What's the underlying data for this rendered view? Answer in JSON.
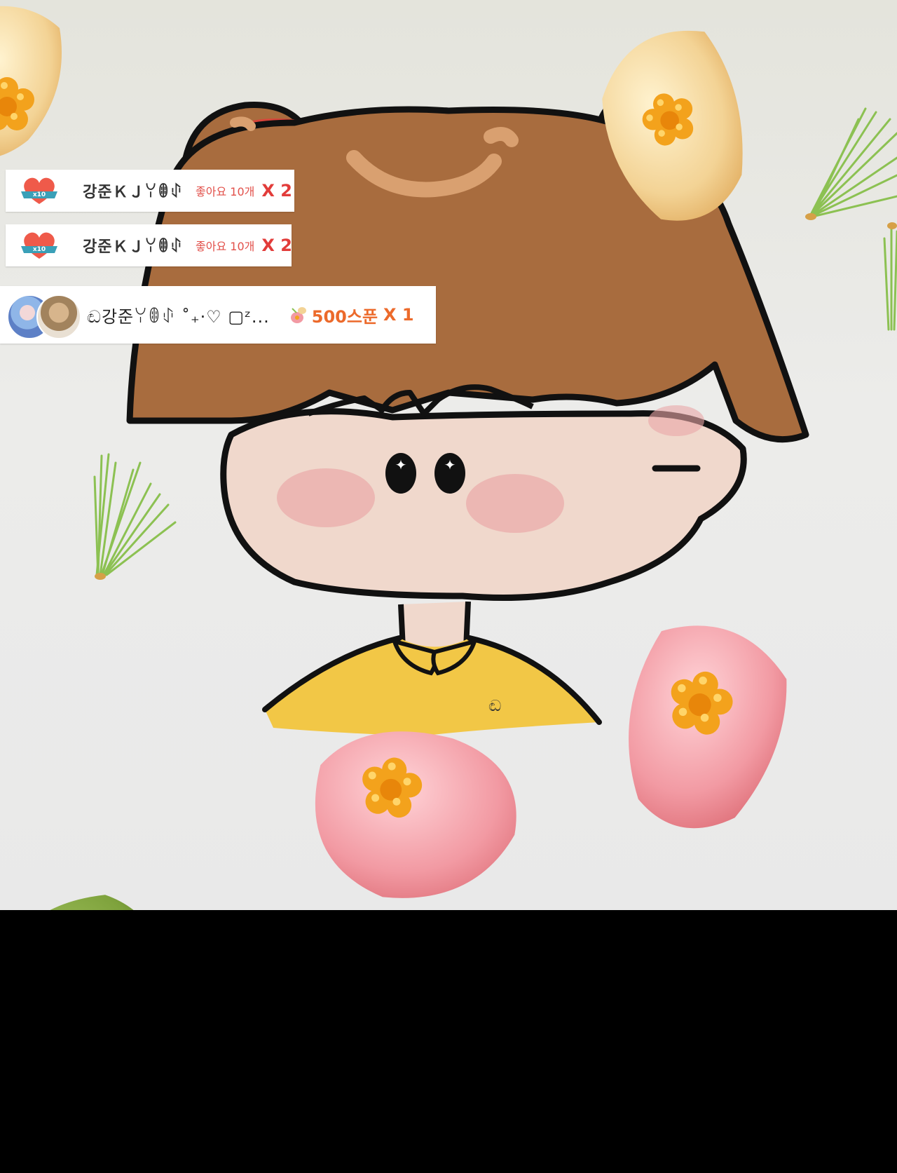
{
  "gift_feed": [
    {
      "badge_label": "x10",
      "user": "강준ＫＪꌩꂦꂑ",
      "item": "좋아요 10개",
      "count": "X 2"
    },
    {
      "badge_label": "x10",
      "user": "강준ＫＪꌩꂦꂑ",
      "item": "좋아요 10개",
      "count": "X 2"
    }
  ],
  "spoon_gift": {
    "user": "ඬ강준ꌩꂦꂑ ˚₊·♡ ▢ᶻ...",
    "amount": "500스푼",
    "count": "X 1"
  },
  "signature_mark": "ඬ",
  "colors": {
    "hair": "#a86c3e",
    "face": "#f0d8cc",
    "shirt": "#f2c746",
    "cake_pink": "#f29aa3",
    "cake_yellow": "#f3d395",
    "cake_green": "#7ea23c",
    "flower_orange": "#f3a21c",
    "gift_text_red": "#e23c3a",
    "spoon_orange": "#ec6a2b"
  }
}
